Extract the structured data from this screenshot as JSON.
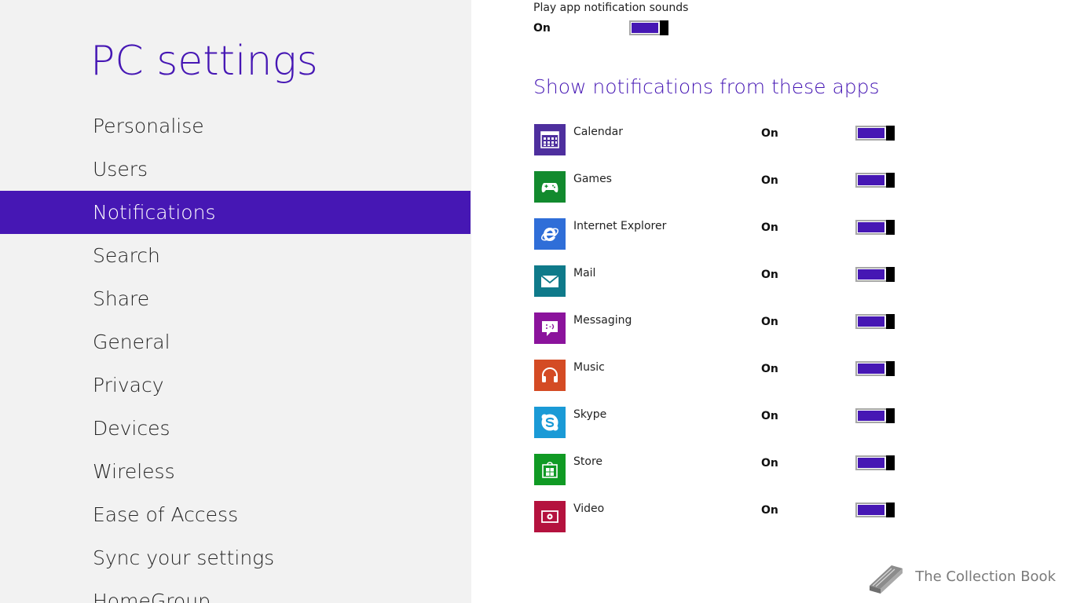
{
  "nav": {
    "title": "PC settings",
    "items": [
      {
        "label": "Personalise",
        "selected": false
      },
      {
        "label": "Users",
        "selected": false
      },
      {
        "label": "Notifications",
        "selected": true
      },
      {
        "label": "Search",
        "selected": false
      },
      {
        "label": "Share",
        "selected": false
      },
      {
        "label": "General",
        "selected": false
      },
      {
        "label": "Privacy",
        "selected": false
      },
      {
        "label": "Devices",
        "selected": false
      },
      {
        "label": "Wireless",
        "selected": false
      },
      {
        "label": "Ease of Access",
        "selected": false
      },
      {
        "label": "Sync your settings",
        "selected": false
      },
      {
        "label": "HomeGroup",
        "selected": false
      }
    ]
  },
  "sounds": {
    "label": "Play app notification sounds",
    "state": "On"
  },
  "apps_section": {
    "heading": "Show notifications from these apps",
    "apps": [
      {
        "name": "Calendar",
        "state": "On",
        "icon": "calendar-icon",
        "color": "#4e2f9e"
      },
      {
        "name": "Games",
        "state": "On",
        "icon": "games-controller-icon",
        "color": "#128a2e"
      },
      {
        "name": "Internet Explorer",
        "state": "On",
        "icon": "internet-explorer-icon",
        "color": "#2f6ed8"
      },
      {
        "name": "Mail",
        "state": "On",
        "icon": "mail-icon",
        "color": "#0f7a8a"
      },
      {
        "name": "Messaging",
        "state": "On",
        "icon": "messaging-icon",
        "color": "#8b139c"
      },
      {
        "name": "Music",
        "state": "On",
        "icon": "music-headphones-icon",
        "color": "#d44b24"
      },
      {
        "name": "Skype",
        "state": "On",
        "icon": "skype-icon",
        "color": "#1a9ad6"
      },
      {
        "name": "Store",
        "state": "On",
        "icon": "store-icon",
        "color": "#109a24"
      },
      {
        "name": "Video",
        "state": "On",
        "icon": "video-icon",
        "color": "#b4123e"
      }
    ]
  },
  "watermark": {
    "text": "The Collection Book",
    "icon": "book-icon"
  },
  "colors": {
    "accent": "#4617b4",
    "nav_background": "#f2f2f2"
  }
}
